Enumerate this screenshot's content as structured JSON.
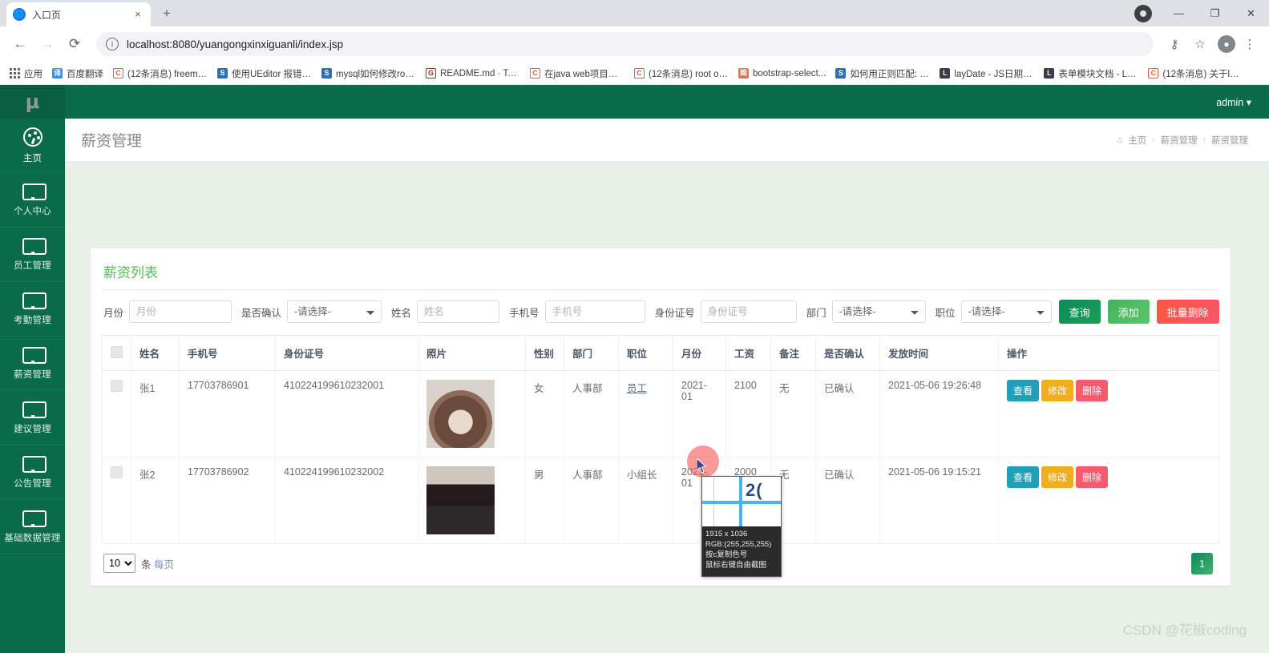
{
  "browser": {
    "tab": {
      "title": "入口页",
      "favicon_icon": "globe-icon",
      "close_icon": "×"
    },
    "newtab_label": "+",
    "window_controls": {
      "minimize": "—",
      "maximize": "❐",
      "close": "✕",
      "record_icon": "record-icon"
    },
    "nav": {
      "back": "←",
      "forward": "→",
      "reload": "⟳"
    },
    "omnibox": {
      "url": "localhost:8080/yuangongxinxiguanli/index.jsp",
      "info_icon": "ⓘ"
    },
    "toolbar_icons": {
      "key": "⚷",
      "bookmark_star": "☆",
      "profile": "👤",
      "menu": "⋮"
    },
    "bookmarks": [
      {
        "label": "应用",
        "icon": "apps-grid-icon",
        "color": "#5f6368"
      },
      {
        "label": "百度翻译",
        "icon": "translate-icon",
        "color": "#3c8ee6"
      },
      {
        "label": "(12条消息) freema...",
        "icon": "csdn-icon",
        "color": "#fc5531"
      },
      {
        "label": "使用UEditor 报错C...",
        "icon": "zhihu-icon",
        "color": "#2f6fb5"
      },
      {
        "label": "mysql如何修改roo...",
        "icon": "zhihu-icon",
        "color": "#2f6fb5"
      },
      {
        "label": "README.md · Ter...",
        "icon": "gitee-icon",
        "color": "#c71d23"
      },
      {
        "label": "在java web项目中...",
        "icon": "csdn-icon",
        "color": "#fc5531"
      },
      {
        "label": "(12条消息) root of...",
        "icon": "csdn-icon",
        "color": "#fc5531"
      },
      {
        "label": "bootstrap-select...",
        "icon": "jianshu-icon",
        "color": "#ea6f5a"
      },
      {
        "label": "如何用正则匹配: 2...",
        "icon": "segmentfault-icon",
        "color": "#2f6fb5"
      },
      {
        "label": "layDate - JS日期与...",
        "icon": "layui-icon",
        "color": "#393d49"
      },
      {
        "label": "表单模块文档 - Lay...",
        "icon": "layui-icon",
        "color": "#393d49"
      },
      {
        "label": "(12条消息) 关于lay...",
        "icon": "csdn-icon",
        "color": "#fc5531"
      }
    ]
  },
  "app": {
    "logo": "μ",
    "topbar": {
      "user": "admin ▾"
    },
    "sidebar": {
      "items": [
        {
          "label": "主页",
          "icon": "dashboard-icon",
          "active": true
        },
        {
          "label": "个人中心",
          "icon": "monitor-icon",
          "active": false
        },
        {
          "label": "员工管理",
          "icon": "monitor-icon",
          "active": false
        },
        {
          "label": "考勤管理",
          "icon": "monitor-icon",
          "active": false
        },
        {
          "label": "薪资管理",
          "icon": "monitor-icon",
          "active": false
        },
        {
          "label": "建议管理",
          "icon": "monitor-icon",
          "active": false
        },
        {
          "label": "公告管理",
          "icon": "monitor-icon",
          "active": false
        },
        {
          "label": "基础数据管理",
          "icon": "monitor-icon",
          "active": false
        }
      ]
    },
    "page_title": "薪资管理",
    "breadcrumb": {
      "home_icon": "home-icon",
      "items": [
        "主页",
        "薪资管理",
        "薪资管理"
      ],
      "separator": "›"
    },
    "card": {
      "title": "薪资列表",
      "filters": {
        "month": {
          "label": "月份",
          "placeholder": "月份",
          "value": ""
        },
        "confirmed": {
          "label": "是否确认",
          "selected": "-请选择-"
        },
        "name": {
          "label": "姓名",
          "placeholder": "姓名",
          "value": ""
        },
        "phone": {
          "label": "手机号",
          "placeholder": "手机号",
          "value": ""
        },
        "idcard": {
          "label": "身份证号",
          "placeholder": "身份证号",
          "value": ""
        },
        "department": {
          "label": "部门",
          "selected": "-请选择-"
        },
        "position": {
          "label": "职位",
          "selected": "-请选择-"
        }
      },
      "buttons": {
        "query": "查询",
        "add": "添加",
        "batch_delete": "批量删除"
      },
      "table": {
        "columns": [
          "",
          "姓名",
          "手机号",
          "身份证号",
          "照片",
          "性别",
          "部门",
          "职位",
          "月份",
          "工资",
          "备注",
          "是否确认",
          "发放时间",
          "操作"
        ],
        "rows": [
          {
            "name": "张1",
            "phone": "17703786901",
            "idcard": "410224199610232001",
            "photo": "female-portrait",
            "gender": "女",
            "department": "人事部",
            "position": "员工",
            "month": "2021-01",
            "salary": "2100",
            "remark": "无",
            "confirmed": "已确认",
            "issue_time": "2021-05-06 19:26:48",
            "actions": [
              "查看",
              "修改",
              "删除"
            ]
          },
          {
            "name": "张2",
            "phone": "17703786902",
            "idcard": "410224199610232002",
            "photo": "male-portrait",
            "gender": "男",
            "department": "人事部",
            "position": "小组长",
            "month": "2021-01",
            "salary": "2000",
            "remark": "无",
            "confirmed": "已确认",
            "issue_time": "2021-05-06 19:15:21",
            "actions": [
              "查看",
              "修改",
              "删除"
            ]
          }
        ]
      },
      "footer": {
        "per_page_value": "10",
        "per_page_suffix": "条",
        "per_page_label": "每页"
      },
      "pagination": {
        "current": "1"
      }
    }
  },
  "overlay": {
    "magnifier": {
      "dimensions": "1915 x 1036",
      "rgb": "RGB:(255,255,255)",
      "hint_copy": "按c复制色号",
      "hint_capture": "鼠标右键自由截图",
      "sample_text": "2("
    },
    "cursor_icon": "mouse-pointer-icon"
  },
  "watermark": "CSDN @花椒coding",
  "colors": {
    "brand_green": "#0a6b4a",
    "title_green": "#5cb85c",
    "btn_query": "#0a8c5c",
    "btn_add": "#44b459",
    "btn_delete": "#f9563f",
    "btn_view": "#20a0b8",
    "btn_edit": "#f0ad1e",
    "btn_row_delete": "#f45b6e",
    "page_bg": "#e8f0e8"
  }
}
